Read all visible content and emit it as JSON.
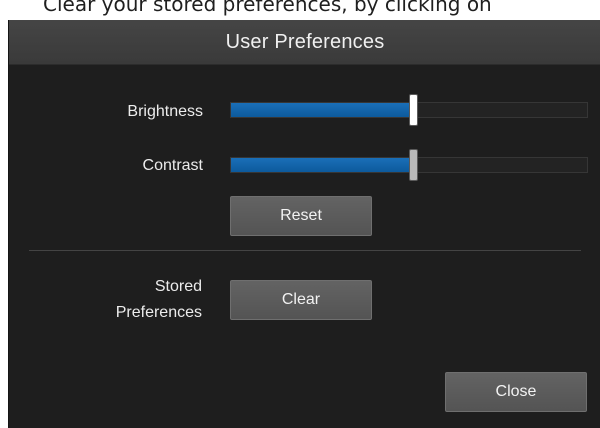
{
  "background": {
    "text": "Clear your stored preferences, by clicking on"
  },
  "dialog": {
    "title": "User Preferences",
    "brightness": {
      "label": "Brightness",
      "value_fraction": 0.51,
      "thumb_state": "active"
    },
    "contrast": {
      "label": "Contrast",
      "value_fraction": 0.51,
      "thumb_state": "inactive"
    },
    "reset_label": "Reset",
    "stored_preferences": {
      "label_line1": "Stored",
      "label_line2": "Preferences",
      "clear_label": "Clear"
    },
    "close_label": "Close"
  },
  "colors": {
    "dialog_bg": "#1e1e1e",
    "titlebar_bg": "#3f3f3f",
    "slider_fill": "#1a6fb8",
    "button_bg": "#5b5b5b"
  }
}
